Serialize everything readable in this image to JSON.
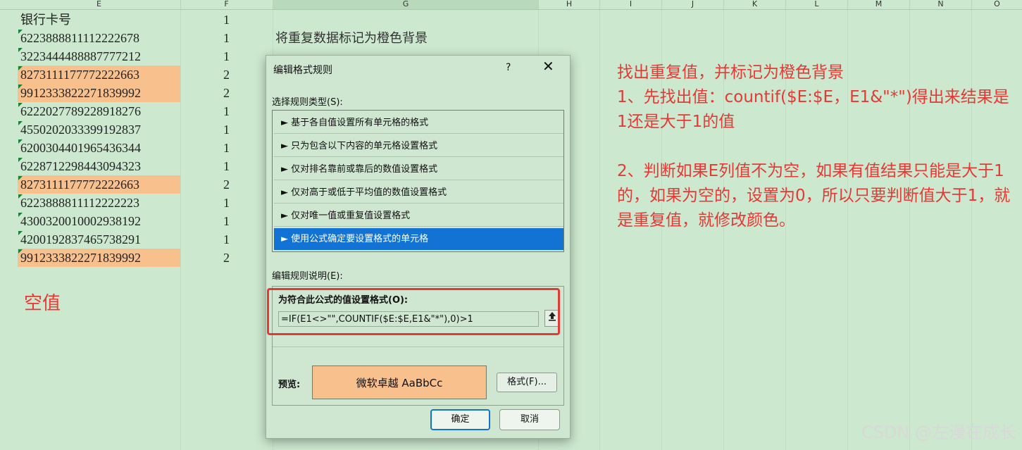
{
  "columns": [
    "E",
    "F",
    "G",
    "H",
    "I",
    "J",
    "K",
    "L",
    "M",
    "N",
    "O"
  ],
  "cells": [
    {
      "e": "银行卡号",
      "f": "1",
      "dup": false,
      "tri": false
    },
    {
      "e": "6223888811112222678",
      "f": "1",
      "dup": false,
      "tri": true
    },
    {
      "e": "3223444488887777212",
      "f": "1",
      "dup": false,
      "tri": true
    },
    {
      "e": "8273111177772222663",
      "f": "2",
      "dup": true,
      "tri": true
    },
    {
      "e": "9912333822271839992",
      "f": "2",
      "dup": true,
      "tri": true
    },
    {
      "e": "6222027789228918276",
      "f": "1",
      "dup": false,
      "tri": true
    },
    {
      "e": "4550202033399192837",
      "f": "1",
      "dup": false,
      "tri": true
    },
    {
      "e": "6200304401965436344",
      "f": "1",
      "dup": false,
      "tri": true
    },
    {
      "e": "6228712298443094323",
      "f": "1",
      "dup": false,
      "tri": true
    },
    {
      "e": "8273111177772222663",
      "f": "2",
      "dup": true,
      "tri": true
    },
    {
      "e": "6223888811112222223",
      "f": "1",
      "dup": false,
      "tri": true
    },
    {
      "e": "4300320010002938192",
      "f": "1",
      "dup": false,
      "tri": true
    },
    {
      "e": "4200192837465738291",
      "f": "1",
      "dup": false,
      "tri": true
    },
    {
      "e": "9912333822271839992",
      "f": "2",
      "dup": true,
      "tri": true
    }
  ],
  "colors": {
    "duplicate_fill": "#f8c08c",
    "sheet_bg": "#cce8cf",
    "annotation_red": "#e53935",
    "selection_blue": "#1273d4"
  },
  "sheet_note": "将重复数据标记为橙色背景",
  "empty_label": "空值",
  "annotation_lines": [
    "找出重复值，并标记为橙色背景",
    "1、先找出值：countif($E:$E，E1&\"*\")得出来结果是1还是大于1的值",
    "2、判断如果E列值不为空，如果有值结果只能是大于1的，如果为空的，设置为0，所以只要判断值大于1，就是重复值，就修改颜色。"
  ],
  "dialog": {
    "title": "编辑格式规则",
    "help": "?",
    "close_icon": "close-icon",
    "rule_type_label": "选择规则类型(S):",
    "rule_types": [
      "► 基于各自值设置所有单元格的格式",
      "► 只为包含以下内容的单元格设置格式",
      "► 仅对排名靠前或靠后的数值设置格式",
      "► 仅对高于或低于平均值的数值设置格式",
      "► 仅对唯一值或重复值设置格式",
      "► 使用公式确定要设置格式的单元格"
    ],
    "selected_rule_index": 5,
    "rule_desc_label": "编辑规则说明(E):",
    "formula_label": "为符合此公式的值设置格式(O):",
    "formula_value": "=IF(E1<>\"\",COUNTIF($E:$E,E1&\"*\"),0)>1",
    "collapse_icon": "upload-arrow-icon",
    "preview_label": "预览:",
    "preview_text": "微软卓越  AaBbCc",
    "format_button": "格式(F)...",
    "ok_button": "确定",
    "cancel_button": "取消"
  },
  "watermark": "CSDN @左漫在成长"
}
